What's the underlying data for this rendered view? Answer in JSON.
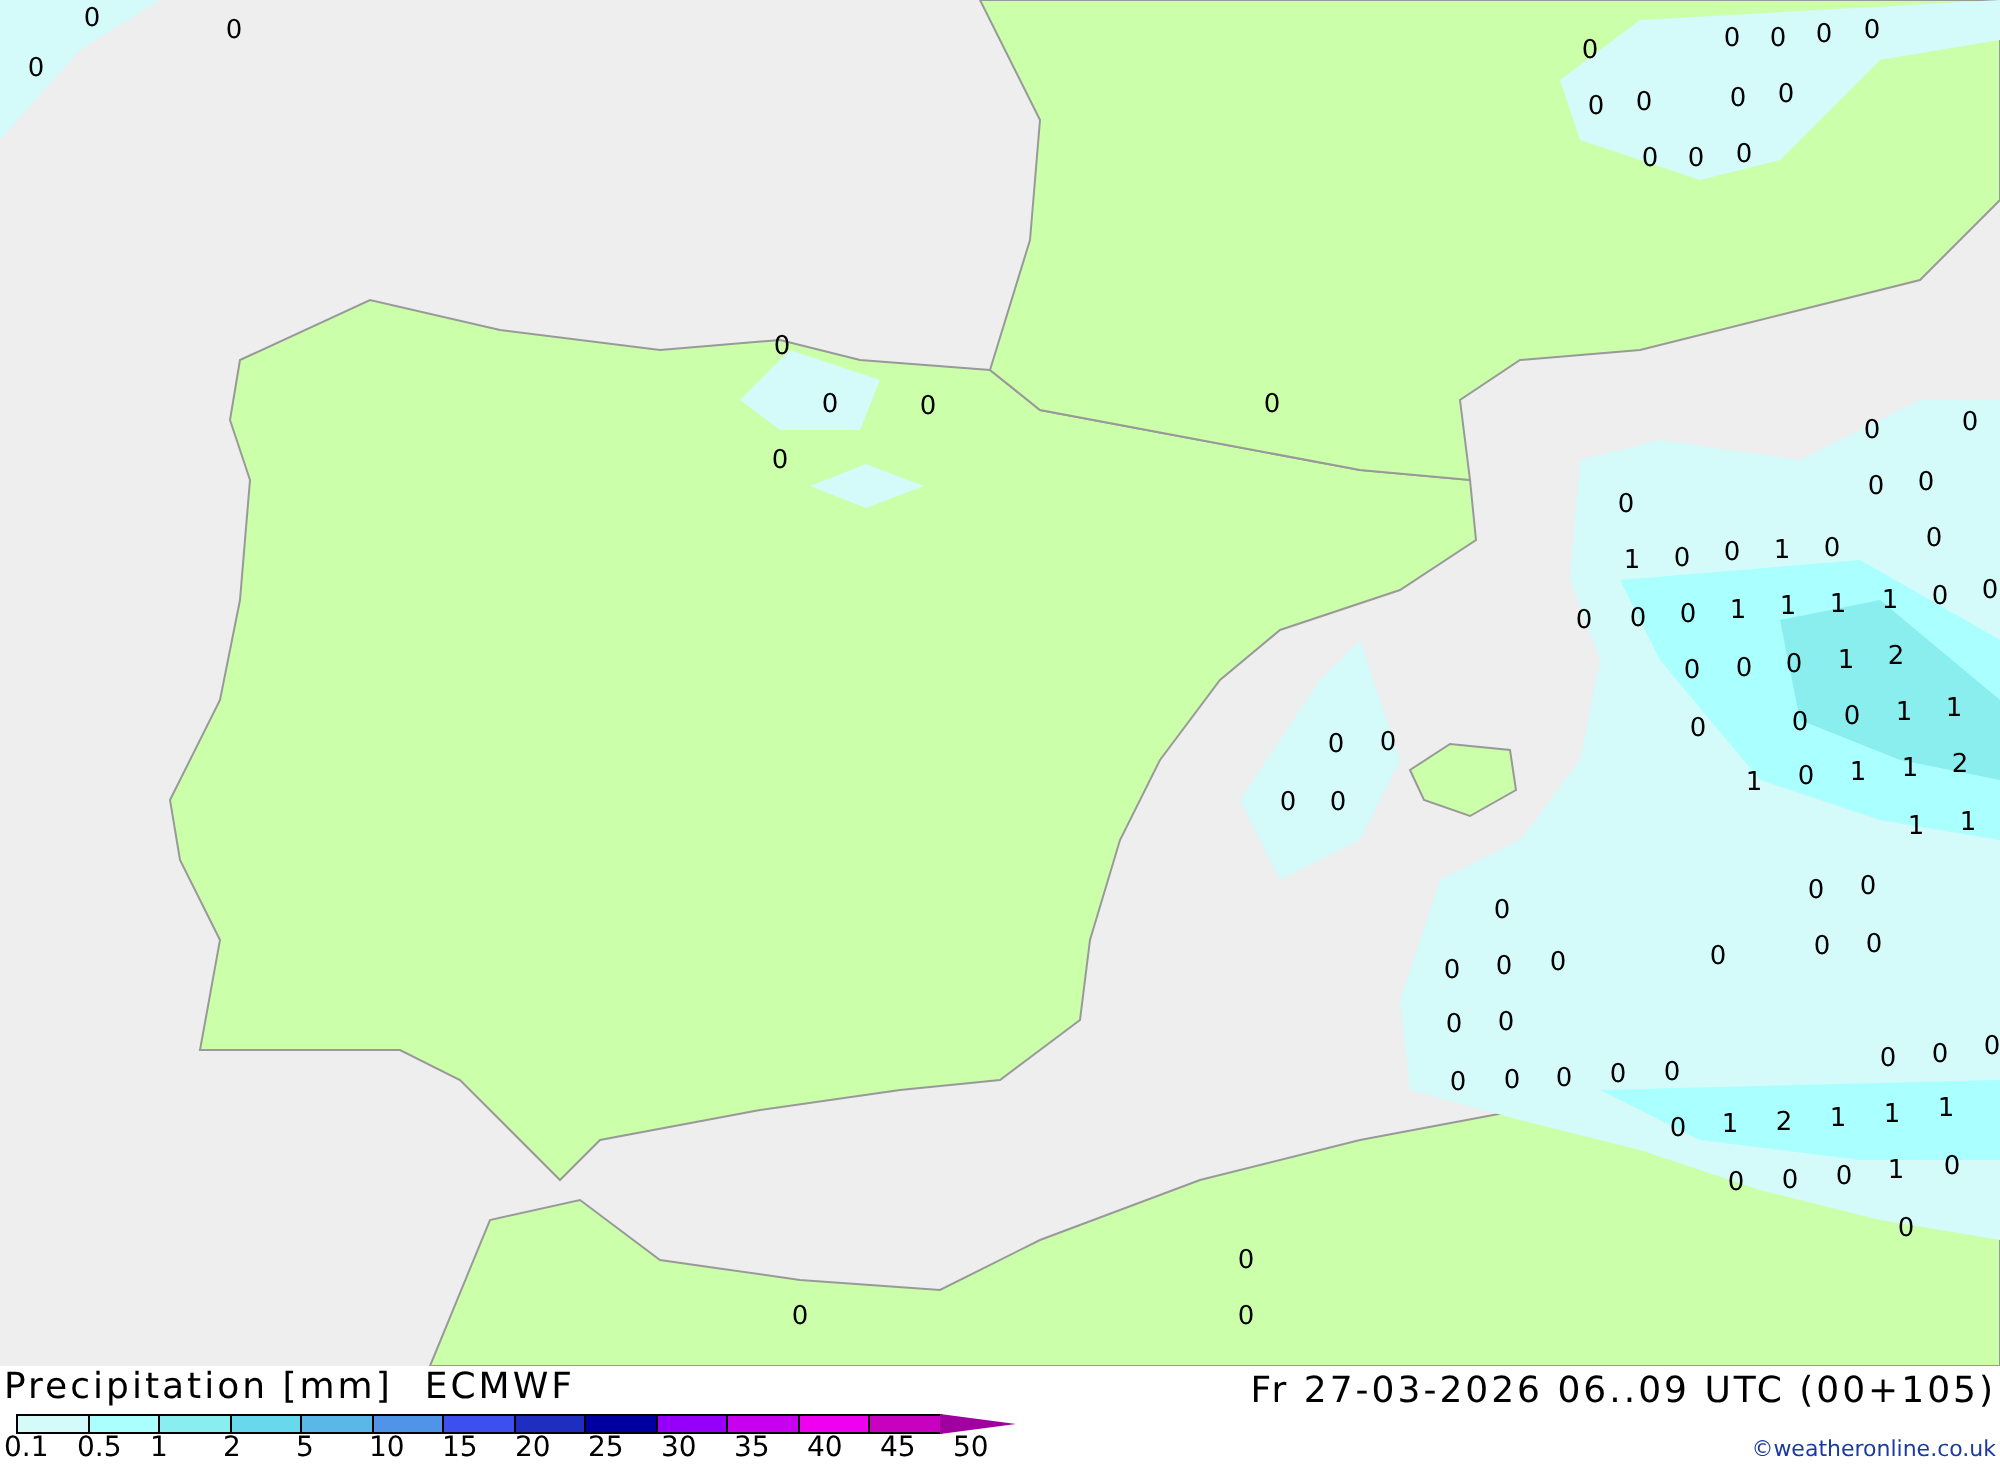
{
  "map": {
    "value_labels": [
      "0",
      "0",
      "0",
      "0",
      "0",
      "0",
      "0",
      "0",
      "0",
      "0",
      "0",
      "0",
      "0",
      "0",
      "0",
      "0",
      "0",
      "0",
      "0",
      "0",
      "0",
      "0",
      "0",
      "0",
      "0",
      "0",
      "1",
      "0",
      "0",
      "1",
      "0",
      "0",
      "0",
      "0",
      "1",
      "1",
      "1",
      "1",
      "0",
      "0",
      "0",
      "0",
      "0",
      "1",
      "2",
      "0",
      "0",
      "0",
      "1",
      "1",
      "1",
      "0",
      "1",
      "1",
      "2",
      "1",
      "1",
      "0",
      "0",
      "0",
      "0",
      "0",
      "0",
      "0",
      "0",
      "0",
      "0",
      "0",
      "0",
      "0",
      "0",
      "0",
      "0",
      "0",
      "0",
      "0",
      "0",
      "0",
      "0",
      "0",
      "0",
      "1",
      "2",
      "1",
      "1",
      "1",
      "0",
      "0",
      "0",
      "1",
      "0",
      "0",
      "0",
      "0",
      "0"
    ]
  },
  "legend": {
    "title": "Precipitation [mm]",
    "model": "ECMWF",
    "boxes": [
      {
        "color": "#d4fafa"
      },
      {
        "color": "#aaffff"
      },
      {
        "color": "#8aeeee"
      },
      {
        "color": "#6ad8ec"
      },
      {
        "color": "#5ab8e8"
      },
      {
        "color": "#5094ea"
      },
      {
        "color": "#3c50f0"
      },
      {
        "color": "#1e2ec0"
      },
      {
        "color": "#0000a0"
      },
      {
        "color": "#9600fa"
      },
      {
        "color": "#c800f0"
      },
      {
        "color": "#f000f0"
      },
      {
        "color": "#c800c0"
      }
    ],
    "arrow": {
      "color": "#a000a0"
    },
    "labels": [
      "0.1",
      "0.5",
      "1",
      "2",
      "5",
      "10",
      "15",
      "20",
      "25",
      "30",
      "35",
      "40",
      "45",
      "50"
    ]
  },
  "valid_time": "Fr 27-03-2026 06..09 UTC (00+105)",
  "copyright": "©weatheronline.co.uk"
}
